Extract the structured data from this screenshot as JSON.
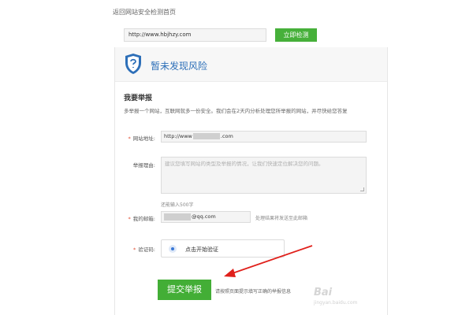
{
  "nav": {
    "back_link": "返回网站安全检测首页"
  },
  "detect": {
    "url_value": "http://www.hbjhzy.com",
    "button_label": "立即检测"
  },
  "result": {
    "text": "暂未发现风险"
  },
  "report": {
    "title": "我要举报",
    "description": "多举报一个网站，互联网就多一份安全。我们会在2天内分析处理您所举报的网站，并尽快给您答复",
    "required_mark": "*",
    "site_label": "网站地址:",
    "site_prefix": "http://www",
    "site_suffix": ".com",
    "reason_label": "举报理由:",
    "reason_placeholder": "建议您填写网站的类型及举报的情况，让我们快速定位解决您的问题。",
    "char_hint": "还能输入500字",
    "email_label": "我的邮箱:",
    "email_suffix": "@qq.com",
    "email_note": "处理结果将发送至此邮箱",
    "captcha_label": "验证码:",
    "captcha_text": "点击开始验证",
    "submit_label": "提交举报",
    "submit_note": "请按照页面提示填写正确的举报信息"
  },
  "watermark": {
    "text": "Bai",
    "sub": "jingyan.baidu.com"
  },
  "colors": {
    "green": "#43ae36",
    "blue": "#2d6fb8",
    "arrow_red": "#e0201b"
  }
}
